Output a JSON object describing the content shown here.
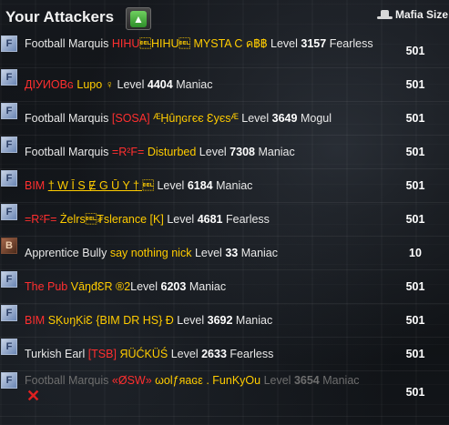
{
  "header": {
    "title": "Your Attackers",
    "up_button_icon": "arrow-up-icon",
    "size_column_label": "Mafia Size"
  },
  "rows": [
    {
      "rank": "Football Marquis",
      "family": "HIHU",
      "name": "\u0007HIHU\u0007 MYSTA C ค฿฿",
      "level_label": "Level",
      "level": "3157",
      "class": "Fearless",
      "size": "501",
      "avatar": "F"
    },
    {
      "rank": "",
      "family": "ДІУИОΒɢ",
      "name": "Lupo ♀",
      "level_label": "Level",
      "level": "4404",
      "class": "Maniac",
      "size": "501",
      "avatar": "F"
    },
    {
      "rank": "Football Marquis",
      "family": "[SOSA]",
      "name": "ᴭḤûŋɢгєє Ɛуєѕᴭ",
      "level_label": "Level",
      "level": "3649",
      "class": "Mogul",
      "size": "501",
      "avatar": "F"
    },
    {
      "rank": "Football Marquis",
      "family": "=R²F=",
      "name": "Disturbed",
      "level_label": "Level",
      "level": "7308",
      "class": "Maniac",
      "size": "501",
      "avatar": "F"
    },
    {
      "rank": "",
      "family": "BIM",
      "name": "† W Ī S Ɇ G Ū Y † \u0007",
      "level_label": "Level",
      "level": "6184",
      "class": "Maniac",
      "size": "501",
      "avatar": "F"
    },
    {
      "rank": "",
      "family": "=R²F=",
      "name": "Żelrs\u0007₮slerance [K]",
      "level_label": "Level",
      "level": "4681",
      "class": "Fearless",
      "size": "501",
      "avatar": "F"
    },
    {
      "rank": "Apprentice Bully",
      "family": "",
      "name": "say nothing nick",
      "level_label": "Level",
      "level": "33",
      "class": "Maniac",
      "size": "10",
      "avatar": "B"
    },
    {
      "rank": "The Pub",
      "family": "",
      "name": "VāŋđƐR ®2",
      "level_label": "Level",
      "level": "6203",
      "class": "Maniac",
      "size": "501",
      "avatar": "F"
    },
    {
      "rank": "",
      "family": "BIM",
      "name": "SḲʋŋḲiƐ {BIM DR HS} Ɖ",
      "level_label": "Level",
      "level": "3692",
      "class": "Maniac",
      "size": "501",
      "avatar": "F"
    },
    {
      "rank": "Turkish Earl",
      "family": "[TSB]",
      "name": "ЯÜĆKÜŚ",
      "level_label": "Level",
      "level": "2633",
      "class": "Fearless",
      "size": "501",
      "avatar": "F"
    },
    {
      "rank": "Football Marquis",
      "family": "«ØSW»",
      "name": "ωοlƒяaɢε . FunKyOu",
      "level_label": "Level",
      "level": "3654",
      "class": "Maniac",
      "size": "501",
      "avatar": "F"
    }
  ]
}
